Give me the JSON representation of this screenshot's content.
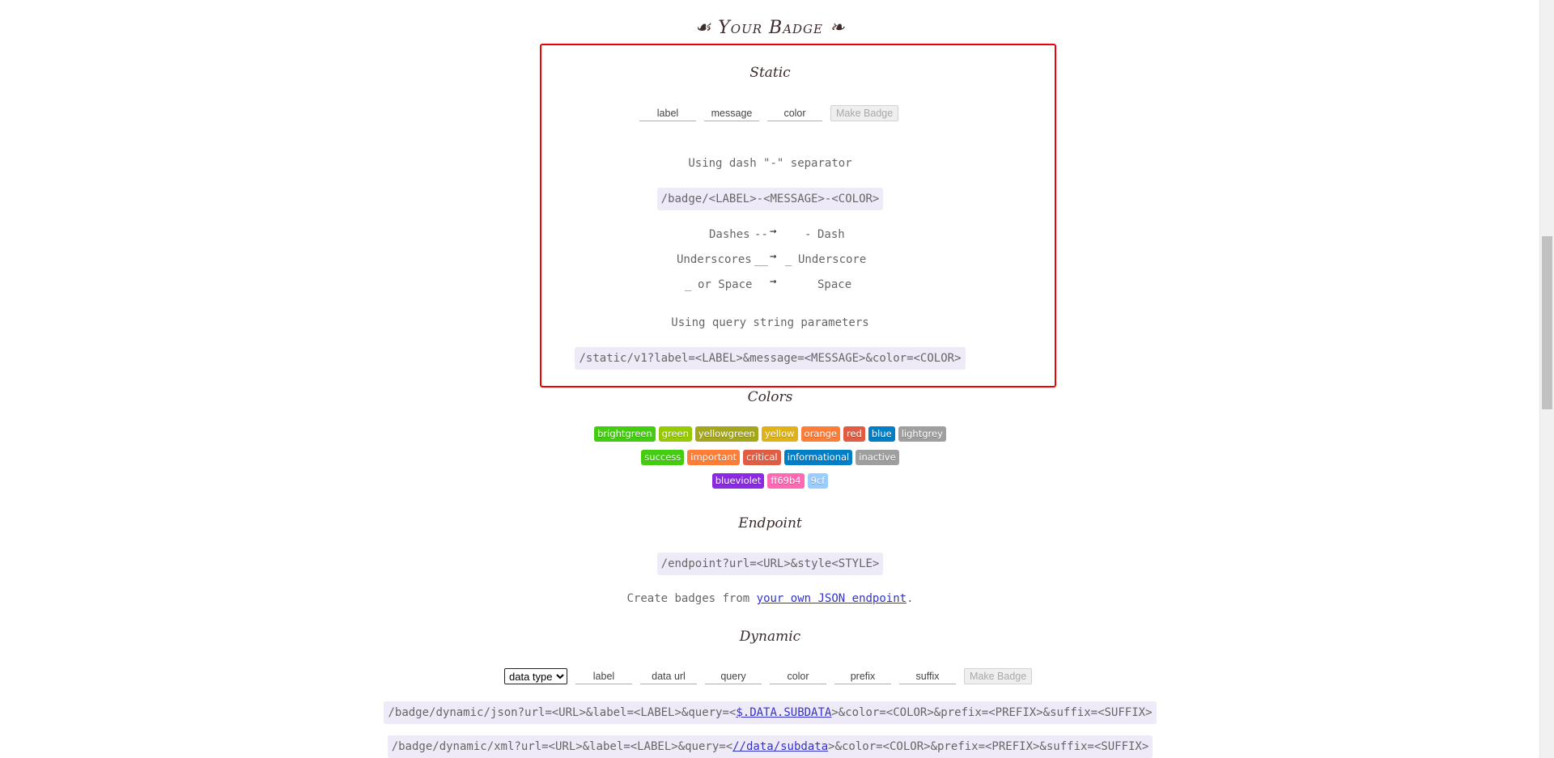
{
  "page": {
    "title": "Your Badge",
    "title_ornament_left": "☙",
    "title_ornament_right": "❧"
  },
  "static": {
    "title": "Static",
    "label_placeholder": "label",
    "message_placeholder": "message",
    "color_placeholder": "color",
    "make_badge_label": "Make Badge",
    "dash_caption": "Using dash \"-\" separator",
    "dash_path": "/badge/<LABEL>-<MESSAGE>-<COLOR>",
    "escapes": [
      {
        "from": "Dashes",
        "code": "--",
        "arrow": "→",
        "to_code": "-",
        "to": "Dash"
      },
      {
        "from": "Underscores",
        "code": "__",
        "arrow": "→",
        "to_code": "_",
        "to": "Underscore"
      },
      {
        "from_code": "_",
        "from": "or Space",
        "arrow": "→",
        "to": "Space"
      }
    ],
    "query_caption": "Using query string parameters",
    "query_path": "/static/v1?label=<LABEL>&message=<MESSAGE>&color=<COLOR>"
  },
  "colors": {
    "title": "Colors",
    "rows": [
      [
        {
          "name": "brightgreen",
          "hex": "#44cc11"
        },
        {
          "name": "green",
          "hex": "#97ca00"
        },
        {
          "name": "yellowgreen",
          "hex": "#a4a61d"
        },
        {
          "name": "yellow",
          "hex": "#dfb317"
        },
        {
          "name": "orange",
          "hex": "#fe7d37"
        },
        {
          "name": "red",
          "hex": "#e05d44"
        },
        {
          "name": "blue",
          "hex": "#007ec6"
        },
        {
          "name": "lightgrey",
          "hex": "#9f9f9f"
        }
      ],
      [
        {
          "name": "success",
          "hex": "#44cc11"
        },
        {
          "name": "important",
          "hex": "#fe7d37"
        },
        {
          "name": "critical",
          "hex": "#e05d44"
        },
        {
          "name": "informational",
          "hex": "#007ec6"
        },
        {
          "name": "inactive",
          "hex": "#9f9f9f"
        }
      ],
      [
        {
          "name": "blueviolet",
          "hex": "#8a2be2"
        },
        {
          "name": "ff69b4",
          "hex": "#ff69b4"
        },
        {
          "name": "9cf",
          "hex": "#99ccff"
        }
      ]
    ]
  },
  "endpoint": {
    "title": "Endpoint",
    "path": "/endpoint?url=<URL>&style<STYLE>",
    "desc_prefix": "Create badges from ",
    "desc_link": "your own JSON endpoint",
    "desc_suffix": "."
  },
  "dynamic": {
    "title": "Dynamic",
    "select_value": "data type",
    "label_placeholder": "label",
    "dataurl_placeholder": "data url",
    "query_placeholder": "query",
    "color_placeholder": "color",
    "prefix_placeholder": "prefix",
    "suffix_placeholder": "suffix",
    "make_badge_label": "Make Badge",
    "json_prefix": "/badge/dynamic/json?url=<URL>&label=<LABEL>&query=<",
    "json_link": "$.DATA.SUBDATA",
    "json_suffix": ">&color=<COLOR>&prefix=<PREFIX>&suffix=<SUFFIX>",
    "xml_prefix": "/badge/dynamic/xml?url=<URL>&label=<LABEL>&query=<",
    "xml_link": "//data/subdata",
    "xml_suffix": ">&color=<COLOR>&prefix=<PREFIX>&suffix=<SUFFIX>"
  }
}
